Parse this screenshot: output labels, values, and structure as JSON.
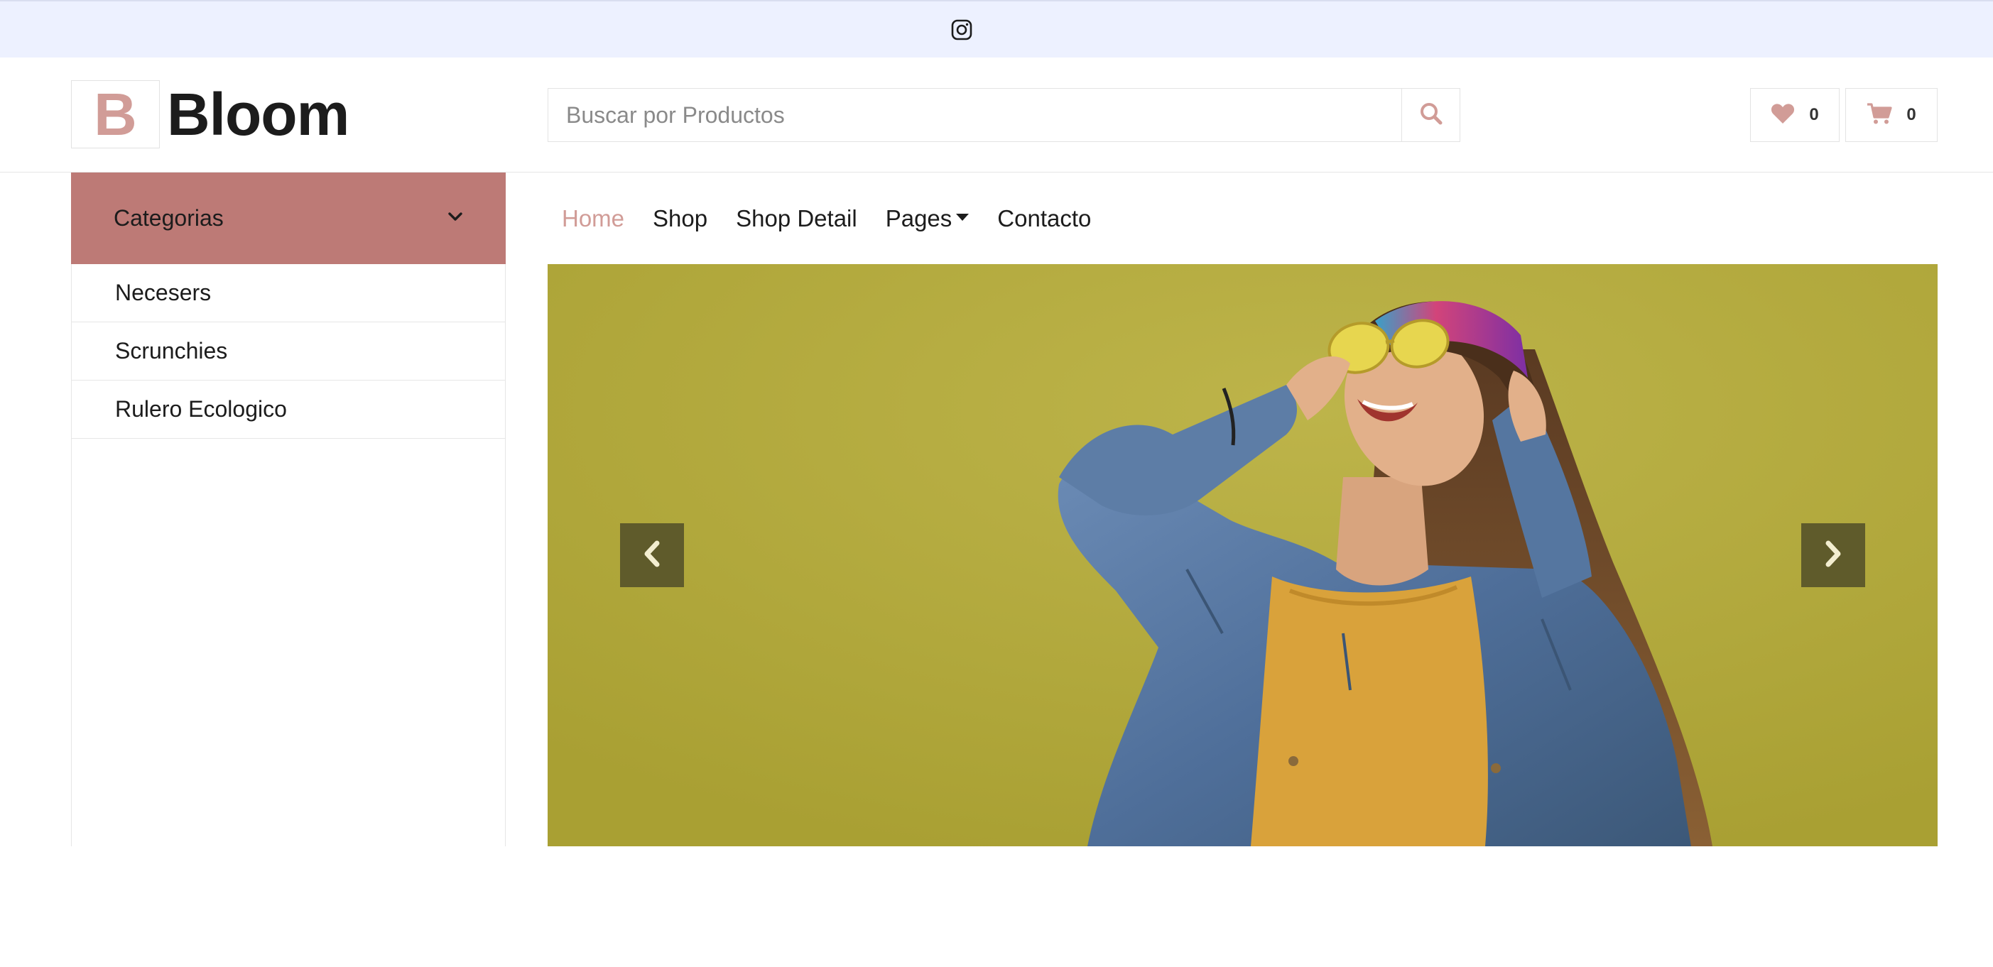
{
  "topbar": {
    "social_icon": "instagram-icon"
  },
  "header": {
    "logo_letter": "B",
    "logo_text": "Bloom",
    "search_placeholder": "Buscar por Productos",
    "search_icon": "search-icon",
    "wishlist_count": "0",
    "cart_count": "0"
  },
  "sidebar": {
    "title": "Categorias",
    "items": [
      {
        "label": "Necesers"
      },
      {
        "label": "Scrunchies"
      },
      {
        "label": "Rulero Ecologico"
      }
    ]
  },
  "nav": {
    "items": [
      {
        "label": "Home",
        "active": true
      },
      {
        "label": "Shop"
      },
      {
        "label": "Shop Detail"
      },
      {
        "label": "Pages",
        "dropdown": true
      },
      {
        "label": "Contacto"
      }
    ]
  },
  "carousel": {
    "prev_icon": "chevron-left-icon",
    "next_icon": "chevron-right-icon"
  },
  "colors": {
    "accent": "#d19c97",
    "category_bar": "#bd7a76",
    "topbar": "#edf1ff",
    "banner_bg": "#b3a93a"
  }
}
